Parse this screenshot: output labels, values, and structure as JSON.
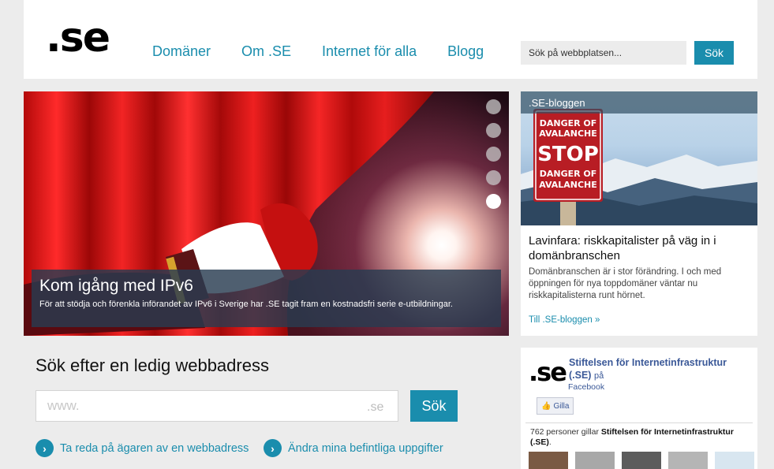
{
  "header": {
    "logo": ".se",
    "nav": [
      "Domäner",
      "Om .SE",
      "Internet för alla",
      "Blogg"
    ],
    "search_placeholder": "Sök på webbplatsen...",
    "search_button": "Sök"
  },
  "hero": {
    "title": "Kom igång med IPv6",
    "text": "För att stödja och förenkla införandet av IPv6 i Sverige har .SE tagit fram en kostnadsfri serie e-utbildningar.",
    "slides_total": 5,
    "active_slide": 5
  },
  "blog": {
    "tag": ".SE-bloggen",
    "sign": [
      "DANGER OF",
      "AVALANCHE",
      "STOP",
      "DANGER OF",
      "AVALANCHE"
    ],
    "title": "Lavinfara: riskkapitalister på väg in i domänbranschen",
    "text": "Domänbranschen är i stor förändring. I och med öppningen för nya toppdomäner väntar nu riskkapitalisterna runt hörnet.",
    "link": "Till .SE-bloggen »"
  },
  "domain_search": {
    "title": "Sök efter en ledig webbadress",
    "placeholder": "www.",
    "suffix": ".se",
    "button": "Sök",
    "links": [
      "Ta reda på ägaren av en webbadress",
      "Ändra mina befintliga uppgifter"
    ]
  },
  "facebook": {
    "logo": ".se",
    "page_name": "Stiftelsen för Internetinfrastruktur (.SE)",
    "on": "på",
    "platform": "Facebook",
    "like_button": "Gilla",
    "count_prefix": "762 personer gillar",
    "count_name": "Stiftelsen för Internetinfrastruktur (.SE)",
    "count_suffix": "."
  },
  "colors": {
    "accent": "#1a8dad",
    "facebook": "#3b5998"
  }
}
